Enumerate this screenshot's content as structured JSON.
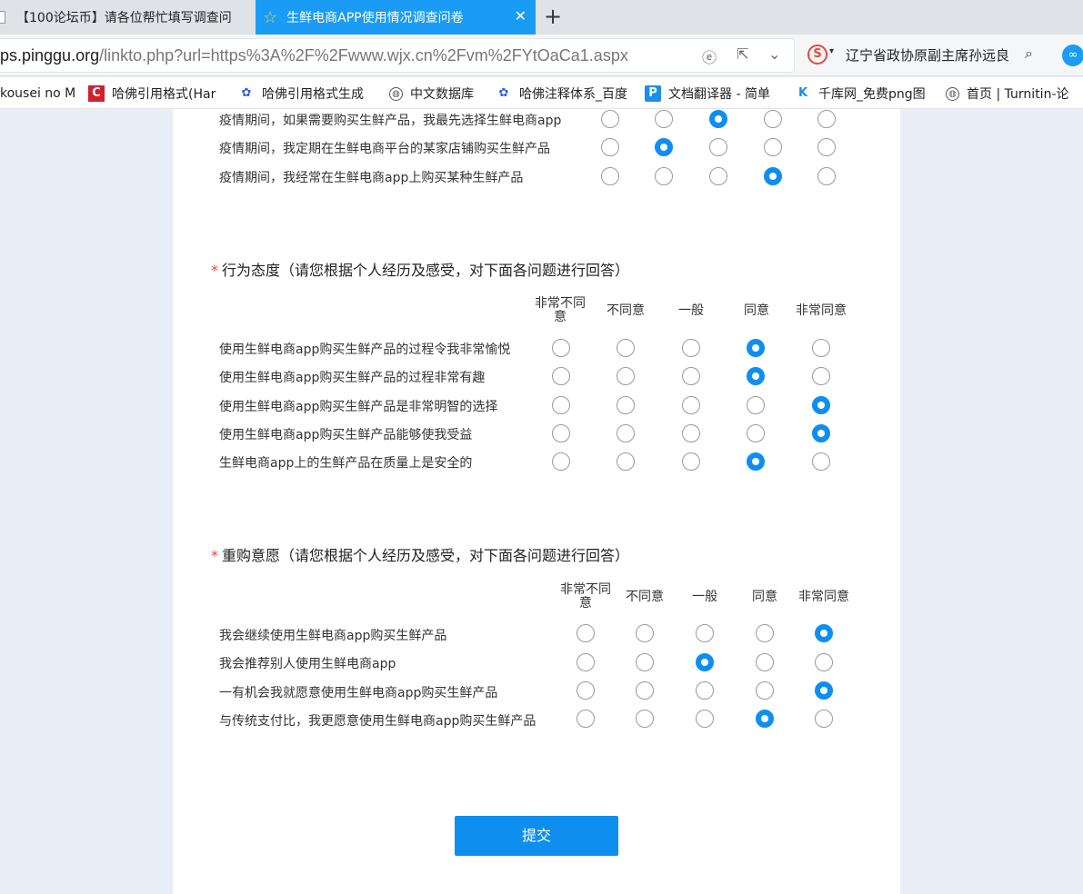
{
  "tabs": [
    {
      "label": "【100论坛币】请各位帮忙填写调查问"
    },
    {
      "label": "生鲜电商APP使用情况调查问卷"
    }
  ],
  "address": {
    "host": "ps.pinggu.org",
    "path": "/linkto.php?url=https%3A%2F%2Fwww.wjx.cn%2Fvm%2FYtOaCa1.aspx"
  },
  "search_box": {
    "text": "辽宁省政协原副主席孙远良"
  },
  "bookmarks": [
    {
      "label": "kousei no M",
      "icon": "none"
    },
    {
      "label": "哈佛引用格式(Har",
      "icon": "c-icon"
    },
    {
      "label": "哈佛引用格式生成",
      "icon": "paw-icon"
    },
    {
      "label": "中文数据库",
      "icon": "globe-icon"
    },
    {
      "label": "哈佛注释体系_百度",
      "icon": "paw-icon"
    },
    {
      "label": "文档翻译器 - 简单",
      "icon": "p-icon"
    },
    {
      "label": "千库网_免费png图",
      "icon": "k-icon"
    },
    {
      "label": "首页 | Turnitin-论",
      "icon": "globe-icon"
    }
  ],
  "colors": {
    "accent": "#0e8ff0",
    "required": "#e8473b",
    "tab_active": "#1b9cf4"
  },
  "section0": {
    "rows": [
      {
        "label": "疫情期间，如果需要购买生鲜产品，我最先选择生鲜电商app",
        "selected": 3
      },
      {
        "label": "疫情期间，我定期在生鲜电商平台的某家店铺购买生鲜产品",
        "selected": 2
      },
      {
        "label": "疫情期间，我经常在生鲜电商app上购买某种生鲜产品",
        "selected": 4
      }
    ]
  },
  "section1": {
    "required_mark": "*",
    "title": "行为态度（请您根据个人经历及感受，对下面各问题进行回答）",
    "columns": [
      "非常不同意",
      "不同意",
      "一般",
      "同意",
      "非常同意"
    ],
    "rows": [
      {
        "label": "使用生鲜电商app购买生鲜产品的过程令我非常愉悦",
        "selected": 4
      },
      {
        "label": "使用生鲜电商app购买生鲜产品的过程非常有趣",
        "selected": 4
      },
      {
        "label": "使用生鲜电商app购买生鲜产品是非常明智的选择",
        "selected": 5
      },
      {
        "label": "使用生鲜电商app购买生鲜产品能够使我受益",
        "selected": 5
      },
      {
        "label": "生鲜电商app上的生鲜产品在质量上是安全的",
        "selected": 4
      }
    ]
  },
  "section2": {
    "required_mark": "*",
    "title": "重购意愿（请您根据个人经历及感受，对下面各问题进行回答）",
    "columns": [
      "非常不同意",
      "不同意",
      "一般",
      "同意",
      "非常同意"
    ],
    "rows": [
      {
        "label": "我会继续使用生鲜电商app购买生鲜产品",
        "selected": 5
      },
      {
        "label": "我会推荐别人使用生鲜电商app",
        "selected": 3
      },
      {
        "label": "一有机会我就愿意使用生鲜电商app购买生鲜产品",
        "selected": 5
      },
      {
        "label": "与传统支付比，我更愿意使用生鲜电商app购买生鲜产品",
        "selected": 4
      }
    ]
  },
  "submit_label": "提交"
}
